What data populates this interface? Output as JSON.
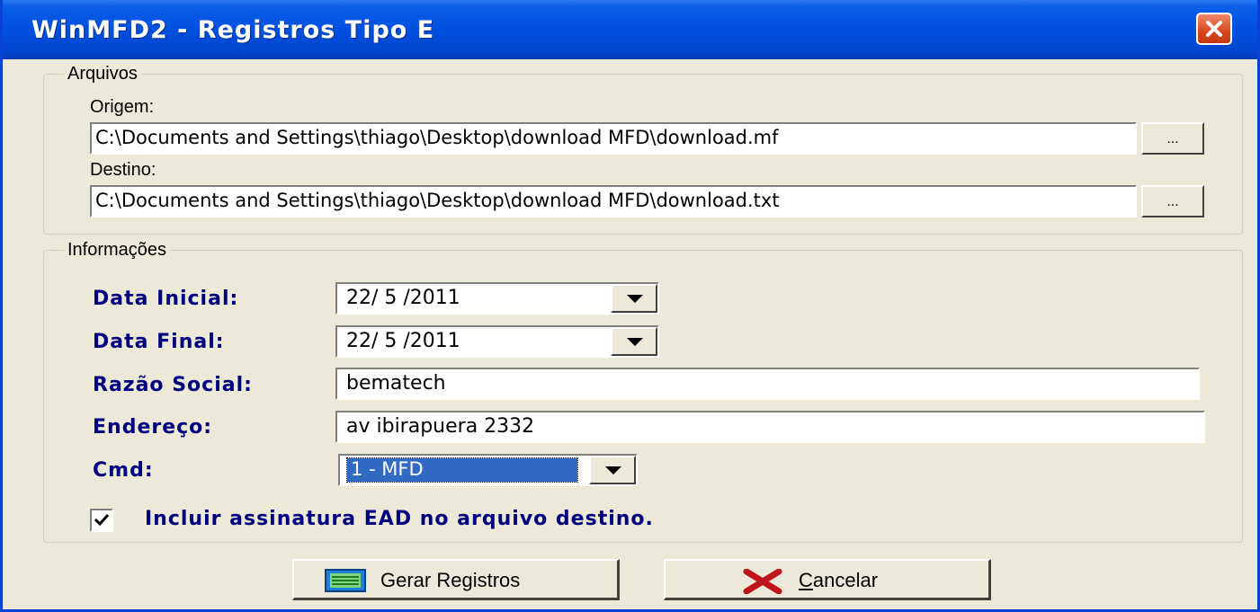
{
  "window": {
    "title": "WinMFD2 - Registros Tipo E"
  },
  "arquivos": {
    "legend": "Arquivos",
    "origem_label": "Origem:",
    "origem_value": "C:\\Documents and Settings\\thiago\\Desktop\\download MFD\\download.mf",
    "destino_label": "Destino:",
    "destino_value": "C:\\Documents and Settings\\thiago\\Desktop\\download MFD\\download.txt",
    "browse_label": "..."
  },
  "informacoes": {
    "legend": "Informações",
    "data_inicial_label": "Data Inicial:",
    "data_inicial_value": "22/ 5 /2011",
    "data_final_label": "Data Final:",
    "data_final_value": "22/ 5 /2011",
    "razao_label": "Razão Social:",
    "razao_value": "bematech",
    "endereco_label": "Endereço:",
    "endereco_value": "av ibirapuera 2332",
    "cmd_label": "Cmd:",
    "cmd_value": "1 - MFD",
    "checkbox_label": "Incluir assinatura EAD no arquivo destino.",
    "checkbox_checked": true
  },
  "buttons": {
    "gerar": "Gerar Registros",
    "cancelar_accel": "C",
    "cancelar_rest": "ancelar"
  },
  "colors": {
    "titlebar": "#0050df",
    "face": "#ece9d8",
    "field_label": "#000080",
    "selection": "#316ac5",
    "close": "#d9461d"
  }
}
